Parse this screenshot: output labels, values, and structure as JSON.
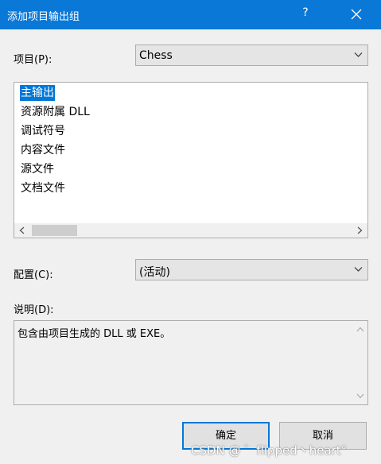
{
  "dialog": {
    "title": "添加项目输出组",
    "help": "?"
  },
  "project": {
    "label": "项目(P):",
    "selected": "Chess"
  },
  "outputs": {
    "items": [
      "主输出",
      "资源附属 DLL",
      "调试符号",
      "内容文件",
      "源文件",
      "文档文件"
    ],
    "selected_index": 0
  },
  "configuration": {
    "label": "配置(C):",
    "selected": "(活动)"
  },
  "description": {
    "label": "说明(D):",
    "text": "包含由项目生成的 DLL 或 EXE。"
  },
  "buttons": {
    "ok": "确定",
    "cancel": "取消"
  },
  "watermark": "CSDN @ ゛flipped丶heart°",
  "colors": {
    "titlebar": "#0a78d7",
    "selection": "#0078d7"
  }
}
